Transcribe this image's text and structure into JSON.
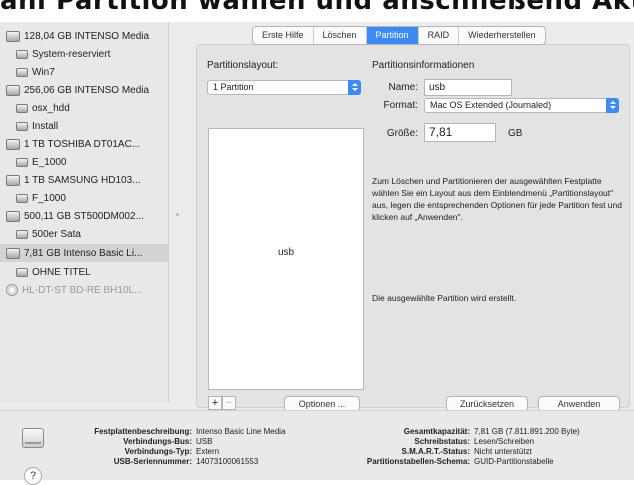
{
  "overlay_caption": "ahl Partition wählen und anschließend Aktiviert",
  "sidebar": {
    "items": [
      {
        "label": "128,04 GB INTENSO Media",
        "type": "disk",
        "child": false
      },
      {
        "label": "System-reserviert",
        "type": "volume",
        "child": true
      },
      {
        "label": "Win7",
        "type": "volume",
        "child": true
      },
      {
        "label": "256,06 GB INTENSO Media",
        "type": "disk",
        "child": false
      },
      {
        "label": "osx_hdd",
        "type": "volume",
        "child": true
      },
      {
        "label": "Install",
        "type": "volume",
        "child": true
      },
      {
        "label": "1 TB TOSHIBA DT01AC...",
        "type": "disk",
        "child": false
      },
      {
        "label": "E_1000",
        "type": "volume",
        "child": true
      },
      {
        "label": "1 TB SAMSUNG HD103...",
        "type": "disk",
        "child": false
      },
      {
        "label": "F_1000",
        "type": "volume",
        "child": true
      },
      {
        "label": "500,11 GB ST500DM002...",
        "type": "disk",
        "child": false
      },
      {
        "label": "500er Sata",
        "type": "volume",
        "child": true
      },
      {
        "label": "7,81 GB Intenso Basic Li...",
        "type": "disk",
        "child": false,
        "selected": true
      },
      {
        "label": "OHNE TITEL",
        "type": "volume",
        "child": true
      },
      {
        "label": "HL-DT-ST BD-RE BH10L...",
        "type": "optical",
        "child": false,
        "dim": true
      }
    ]
  },
  "tabs": [
    {
      "label": "Erste Hilfe",
      "active": false
    },
    {
      "label": "Löschen",
      "active": false
    },
    {
      "label": "Partition",
      "active": true
    },
    {
      "label": "RAID",
      "active": false
    },
    {
      "label": "Wiederherstellen",
      "active": false
    }
  ],
  "partition": {
    "layout_title": "Partitionslayout:",
    "layout_value": "1 Partition",
    "box_label": "usb",
    "info_title": "Partitionsinformationen",
    "name_label": "Name:",
    "name_value": "usb",
    "format_label": "Format:",
    "format_value": "Mac OS Extended (Journaled)",
    "size_label": "Größe:",
    "size_value": "7,81",
    "size_unit": "GB",
    "description": "Zum Löschen und Partitionieren der ausgewählten Festplatte wählen Sie ein Layout aus dem Einblendmenü „Partitionslayout\" aus, legen die entsprechenden Optionen für jede Partition fest und klicken auf „Anwenden\".",
    "status": "Die ausgewählte Partition wird erstellt.",
    "add_symbol": "+",
    "remove_symbol": "−",
    "options_button": "Optionen ...",
    "revert_button": "Zurücksetzen",
    "apply_button": "Anwenden"
  },
  "info": {
    "left": [
      {
        "key": "Festplattenbeschreibung:",
        "value": "Intenso Basic Line Media"
      },
      {
        "key": "Verbindungs-Bus:",
        "value": "USB"
      },
      {
        "key": "Verbindungs-Typ:",
        "value": "Extern"
      },
      {
        "key": "USB-Seriennummer:",
        "value": "14073100061553"
      }
    ],
    "right": [
      {
        "key": "Gesamtkapazität:",
        "value": "7,81 GB (7.811.891.200 Byte)"
      },
      {
        "key": "Schreibstatus:",
        "value": "Lesen/Schreiben"
      },
      {
        "key": "S.M.A.R.T.-Status:",
        "value": "Nicht unterstützt"
      },
      {
        "key": "Partitionstabellen-Schema:",
        "value": "GUID-Partitionstabelle"
      }
    ],
    "help_symbol": "?"
  },
  "colors": {
    "accent": "#3d8bf2",
    "sidebar_selected": "#d3d3d3"
  }
}
